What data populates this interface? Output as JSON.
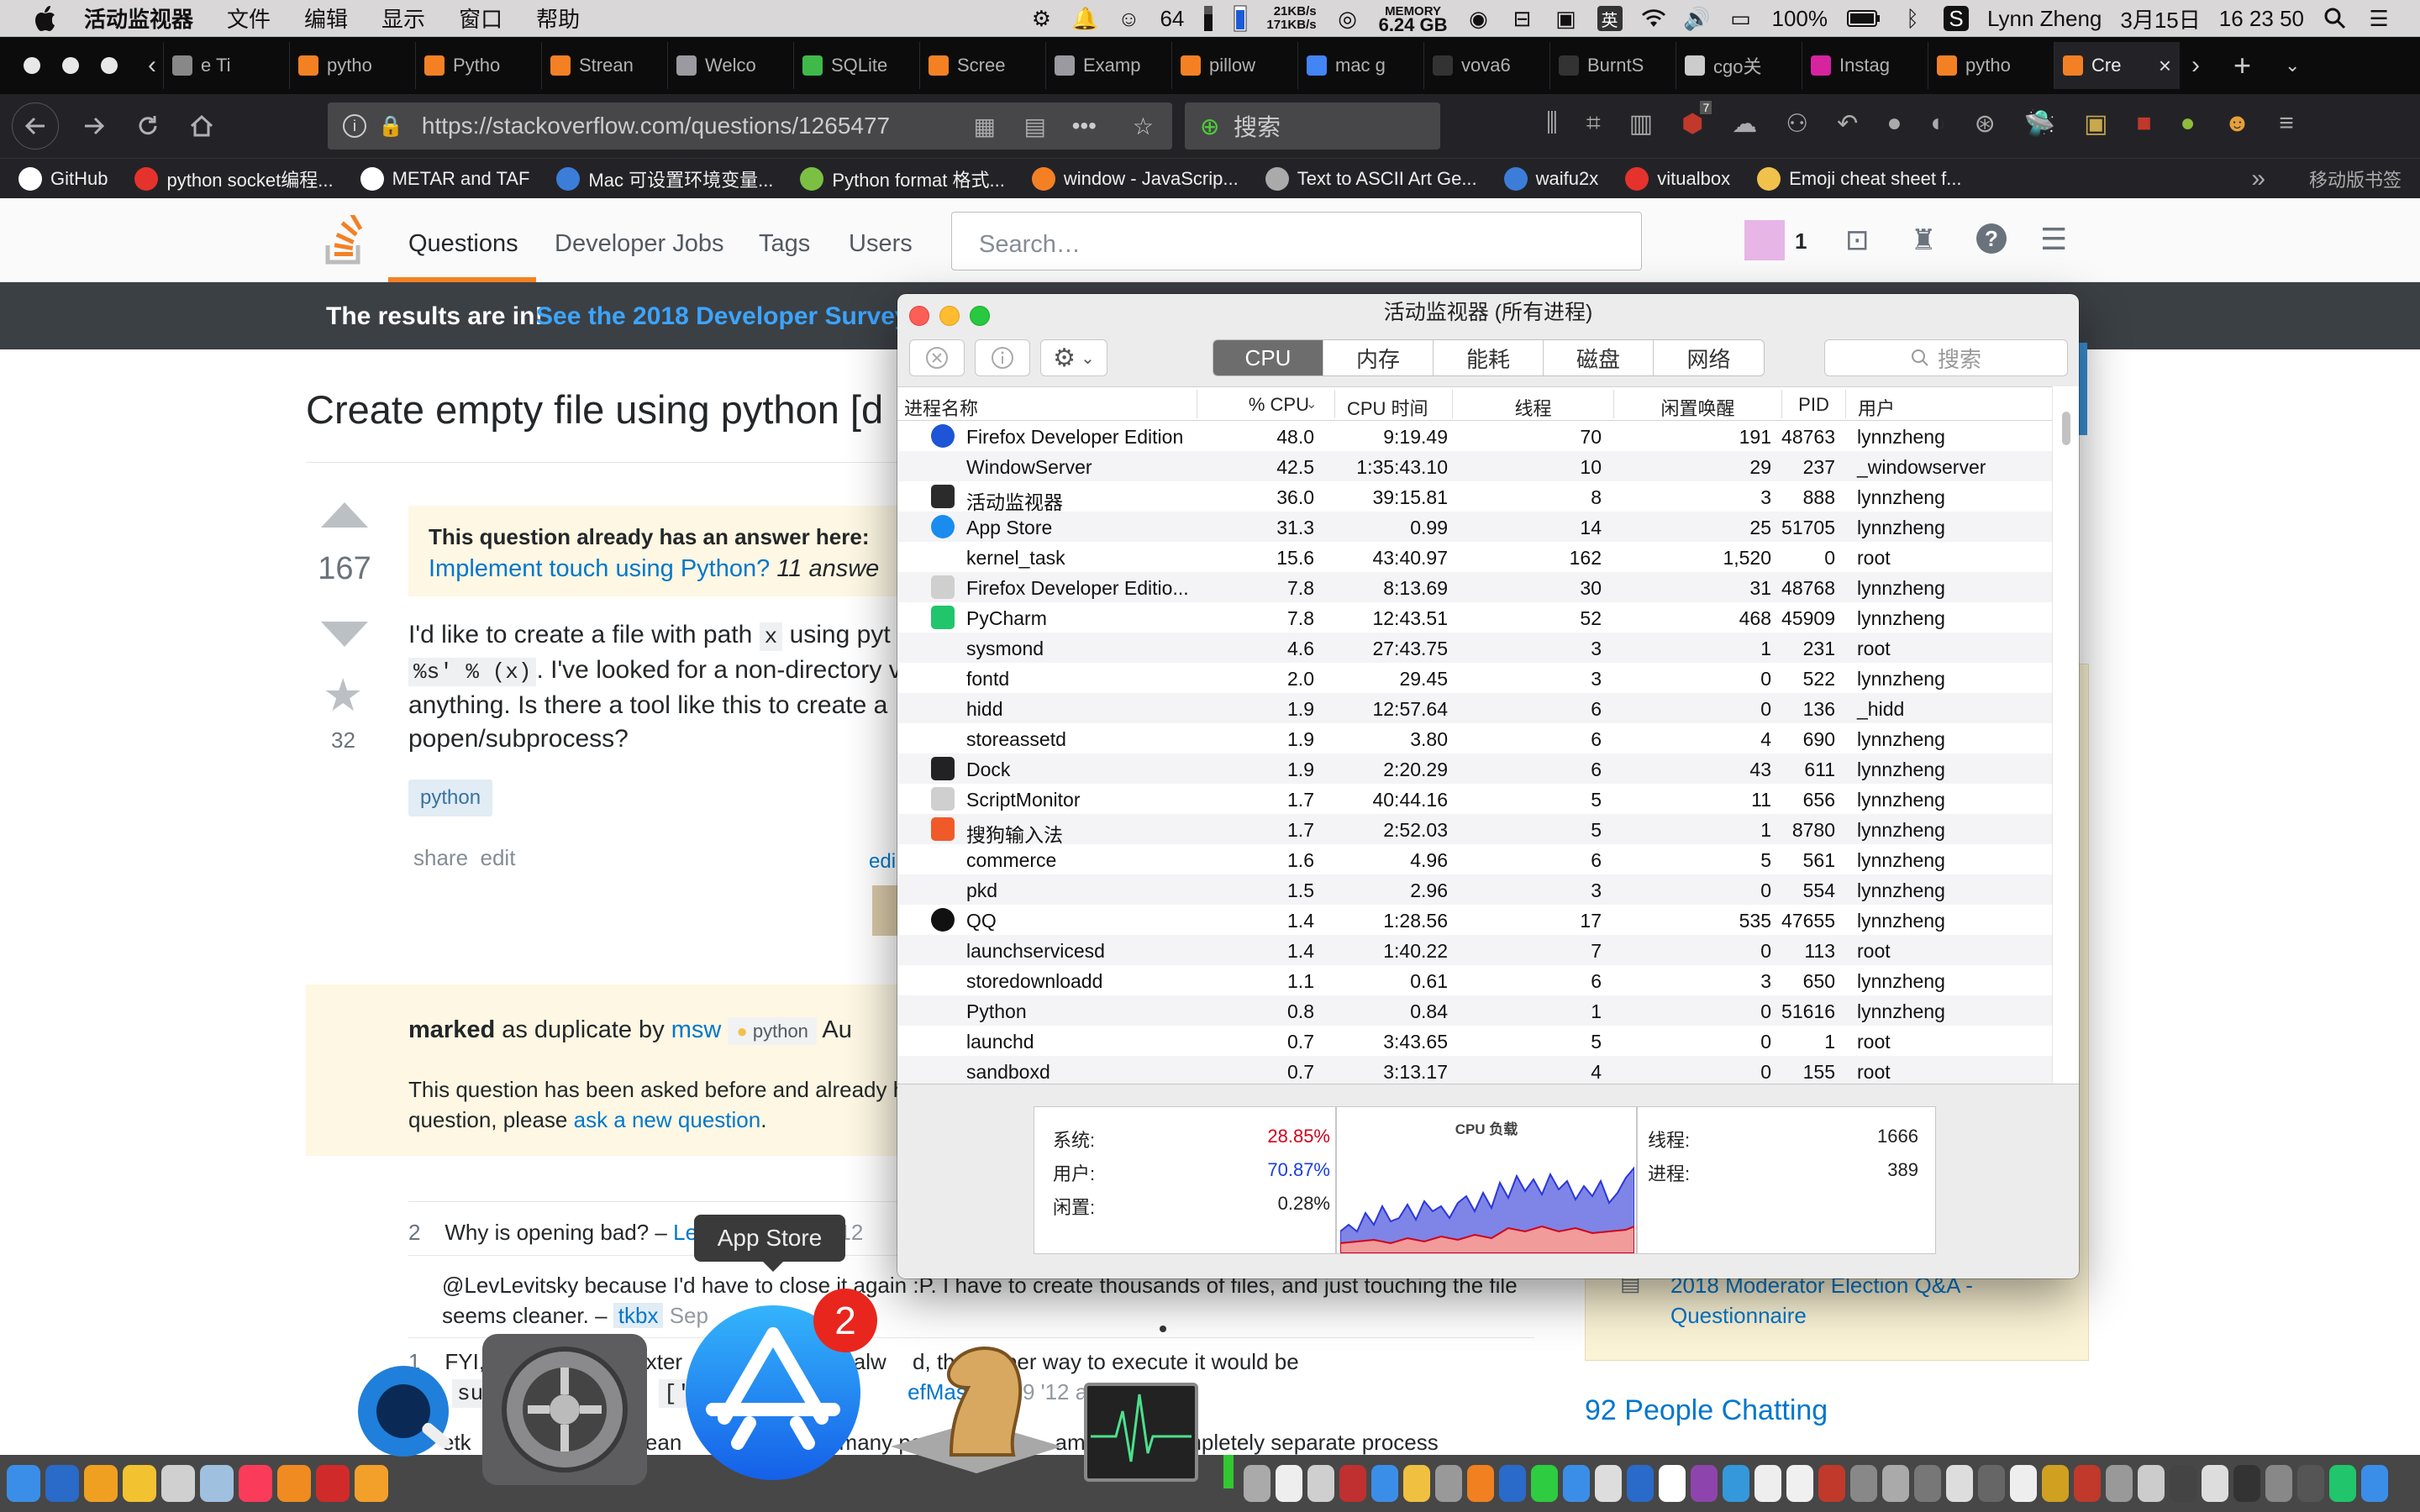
{
  "menubar": {
    "app_name": "活动监视器",
    "items": [
      "文件",
      "编辑",
      "显示",
      "窗口",
      "帮助"
    ],
    "badge_number": "64",
    "net_up": "21KB/s",
    "net_down": "171KB/s",
    "memory_label": "MEMORY",
    "memory_value": "6.24 GB",
    "input_lang": "英",
    "battery": "100%",
    "user": "Lynn Zheng",
    "date": "3月15日",
    "time": "16 23 50"
  },
  "browser": {
    "tabs": [
      {
        "label": "e Ti",
        "color": "#888888"
      },
      {
        "label": "pytho",
        "color": "#f48024"
      },
      {
        "label": "Pytho",
        "color": "#f48024"
      },
      {
        "label": "Strean",
        "color": "#f48024"
      },
      {
        "label": "Welco",
        "color": "#9a9aa0"
      },
      {
        "label": "SQLite",
        "color": "#3fba4a"
      },
      {
        "label": "Scree",
        "color": "#f48024"
      },
      {
        "label": "Examp",
        "color": "#9a9aa0"
      },
      {
        "label": "pillow",
        "color": "#f48024"
      },
      {
        "label": "mac g",
        "color": "#4285f4"
      },
      {
        "label": "vova6",
        "color": "#333333"
      },
      {
        "label": "BurntS",
        "color": "#333333"
      },
      {
        "label": "cgo关",
        "color": "#cccccc"
      },
      {
        "label": "Instag",
        "color": "#d6249f"
      },
      {
        "label": "pytho",
        "color": "#f48024"
      },
      {
        "label": "Cre",
        "color": "#f48024"
      }
    ],
    "url": "https://stackoverflow.com/questions/1265477",
    "search_placeholder": "搜索",
    "ublock_count": "7",
    "bookmarks": [
      {
        "label": "GitHub",
        "color": "#ffffff"
      },
      {
        "label": "python socket编程...",
        "color": "#e5322d"
      },
      {
        "label": "METAR and TAF",
        "color": "#ffffff"
      },
      {
        "label": "Mac 可设置环境变量...",
        "color": "#3b7dd8"
      },
      {
        "label": "Python format 格式...",
        "color": "#7bc043"
      },
      {
        "label": "window - JavaScrip...",
        "color": "#f48024"
      },
      {
        "label": "Text to ASCII Art Ge...",
        "color": "#aaaaaa"
      },
      {
        "label": "waifu2x",
        "color": "#3b7dd8"
      },
      {
        "label": "vitualbox",
        "color": "#e5322d"
      },
      {
        "label": "Emoji cheat sheet f...",
        "color": "#f0c24b"
      }
    ],
    "mobile_bookmarks": "移动版书签"
  },
  "so": {
    "nav": [
      "Questions",
      "Developer Jobs",
      "Tags",
      "Users"
    ],
    "search_placeholder": "Search…",
    "rep": "1",
    "banner_text": "The results are in!",
    "banner_link": "See the 2018 Developer Survey",
    "title": "Create empty file using python [d",
    "votes": "167",
    "favorites": "32",
    "dup_heading": "This question already has an answer here:",
    "dup_link": "Implement touch using Python?",
    "dup_count": "11 answe",
    "body_l1a": "I'd like to create a file with path",
    "body_code1": "x",
    "body_l1b": "using pyt",
    "body_code2": "%s' % (x)",
    "body_l2": ". I've looked for a non-directory ve",
    "body_l3": "anything. Is there a tool like this to create a",
    "body_l4": "popen/subprocess?",
    "tag": "python",
    "share": "share",
    "edit": "edit",
    "edit2": "edi",
    "marked_bold": "marked",
    "marked_rest": "as duplicate by",
    "marked_user": "msw",
    "marked_tag": "python",
    "marked_date": "Au",
    "marked_l1": "This question has been asked before and already h",
    "marked_l2a": "question, please",
    "marked_l2link": "ask a new question",
    "comment1_score": "2",
    "comment1": "Why is opening bad? –",
    "comment1_user": "Le",
    "comment1_date": "29 '12",
    "comment2": "@LevLevitsky because I'd have to close it again :P. I have to create thousands of files, and just touching the file",
    "comment2b": "seems cleaner. –",
    "comment2_user": "tkbx",
    "comment2_date": "Sep",
    "comment3_score": "1",
    "comment3a": "FYI,",
    "comment3b": "exter",
    "comment3c": "his is alw",
    "comment3d": "d, the proper way to execute it would be",
    "comment3e": "sub",
    "comment3f": "['t",
    "comment3user": "efMaster",
    "comment3date": "29 '12 at 17:01",
    "comment4a": "etk",
    "comment4b": "ean",
    "comment4c": "many pe",
    "comment4d": "ampl",
    "comment4e": "a completely separate process",
    "sidebar_link1": "2018 Moderator Election Q&A -",
    "sidebar_link2": "Questionnaire",
    "people_chatting": "92 People Chatting"
  },
  "activity_monitor": {
    "title": "活动监视器 (所有进程)",
    "tabs": [
      "CPU",
      "内存",
      "能耗",
      "磁盘",
      "网络"
    ],
    "selected_tab": "CPU",
    "search_placeholder": "搜索",
    "columns": [
      "进程名称",
      "% CPU",
      "CPU 时间",
      "线程",
      "闲置唤醒",
      "PID",
      "用户"
    ],
    "processes": [
      {
        "name": "Firefox Developer Edition",
        "cpu": "48.0",
        "time": "9:19.49",
        "threads": "70",
        "idle": "191",
        "pid": "48763",
        "user": "lynnzheng",
        "icon": "firefox"
      },
      {
        "name": "WindowServer",
        "cpu": "42.5",
        "time": "1:35:43.10",
        "threads": "10",
        "idle": "29",
        "pid": "237",
        "user": "_windowserver",
        "icon": ""
      },
      {
        "name": "活动监视器",
        "cpu": "36.0",
        "time": "39:15.81",
        "threads": "8",
        "idle": "3",
        "pid": "888",
        "user": "lynnzheng",
        "icon": "activity"
      },
      {
        "name": "App Store",
        "cpu": "31.3",
        "time": "0.99",
        "threads": "14",
        "idle": "25",
        "pid": "51705",
        "user": "lynnzheng",
        "icon": "appstore"
      },
      {
        "name": "kernel_task",
        "cpu": "15.6",
        "time": "43:40.97",
        "threads": "162",
        "idle": "1,520",
        "pid": "0",
        "user": "root",
        "icon": ""
      },
      {
        "name": "Firefox Developer Editio...",
        "cpu": "7.8",
        "time": "8:13.69",
        "threads": "30",
        "idle": "31",
        "pid": "48768",
        "user": "lynnzheng",
        "icon": "doc"
      },
      {
        "name": "PyCharm",
        "cpu": "7.8",
        "time": "12:43.51",
        "threads": "52",
        "idle": "468",
        "pid": "45909",
        "user": "lynnzheng",
        "icon": "pycharm"
      },
      {
        "name": "sysmond",
        "cpu": "4.6",
        "time": "27:43.75",
        "threads": "3",
        "idle": "1",
        "pid": "231",
        "user": "root",
        "icon": ""
      },
      {
        "name": "fontd",
        "cpu": "2.0",
        "time": "29.45",
        "threads": "3",
        "idle": "0",
        "pid": "522",
        "user": "lynnzheng",
        "icon": ""
      },
      {
        "name": "hidd",
        "cpu": "1.9",
        "time": "12:57.64",
        "threads": "6",
        "idle": "0",
        "pid": "136",
        "user": "_hidd",
        "icon": ""
      },
      {
        "name": "storeassetd",
        "cpu": "1.9",
        "time": "3.80",
        "threads": "6",
        "idle": "4",
        "pid": "690",
        "user": "lynnzheng",
        "icon": ""
      },
      {
        "name": "Dock",
        "cpu": "1.9",
        "time": "2:20.29",
        "threads": "6",
        "idle": "43",
        "pid": "611",
        "user": "lynnzheng",
        "icon": "dock"
      },
      {
        "name": "ScriptMonitor",
        "cpu": "1.7",
        "time": "40:44.16",
        "threads": "5",
        "idle": "11",
        "pid": "656",
        "user": "lynnzheng",
        "icon": "doc"
      },
      {
        "name": "搜狗输入法",
        "cpu": "1.7",
        "time": "2:52.03",
        "threads": "5",
        "idle": "1",
        "pid": "8780",
        "user": "lynnzheng",
        "icon": "sogou"
      },
      {
        "name": "commerce",
        "cpu": "1.6",
        "time": "4.96",
        "threads": "6",
        "idle": "5",
        "pid": "561",
        "user": "lynnzheng",
        "icon": ""
      },
      {
        "name": "pkd",
        "cpu": "1.5",
        "time": "2.96",
        "threads": "3",
        "idle": "0",
        "pid": "554",
        "user": "lynnzheng",
        "icon": ""
      },
      {
        "name": "QQ",
        "cpu": "1.4",
        "time": "1:28.56",
        "threads": "17",
        "idle": "535",
        "pid": "47655",
        "user": "lynnzheng",
        "icon": "qq"
      },
      {
        "name": "launchservicesd",
        "cpu": "1.4",
        "time": "1:40.22",
        "threads": "7",
        "idle": "0",
        "pid": "113",
        "user": "root",
        "icon": ""
      },
      {
        "name": "storedownloadd",
        "cpu": "1.1",
        "time": "0.61",
        "threads": "6",
        "idle": "3",
        "pid": "650",
        "user": "lynnzheng",
        "icon": ""
      },
      {
        "name": "Python",
        "cpu": "0.8",
        "time": "0.84",
        "threads": "1",
        "idle": "0",
        "pid": "51616",
        "user": "lynnzheng",
        "icon": ""
      },
      {
        "name": "launchd",
        "cpu": "0.7",
        "time": "3:43.65",
        "threads": "5",
        "idle": "0",
        "pid": "1",
        "user": "root",
        "icon": ""
      },
      {
        "name": "sandboxd",
        "cpu": "0.7",
        "time": "3:13.17",
        "threads": "4",
        "idle": "0",
        "pid": "155",
        "user": "root",
        "icon": ""
      }
    ],
    "stats": {
      "system_label": "系统:",
      "system_value": "28.85%",
      "system_color": "#d0021b",
      "user_label": "用户:",
      "user_value": "70.87%",
      "user_color": "#1a3fd6",
      "idle_label": "闲置:",
      "idle_value": "0.28%",
      "load_title": "CPU 负载",
      "threads_label": "线程:",
      "threads_value": "1666",
      "procs_label": "进程:",
      "procs_value": "389"
    }
  },
  "dock": {
    "tooltip": "App Store",
    "badge": "2"
  },
  "colors": {
    "so_orange": "#f48024",
    "so_link": "#0077cc",
    "browser_dark": "#232327",
    "selected_seg": "#6d6d6d"
  }
}
